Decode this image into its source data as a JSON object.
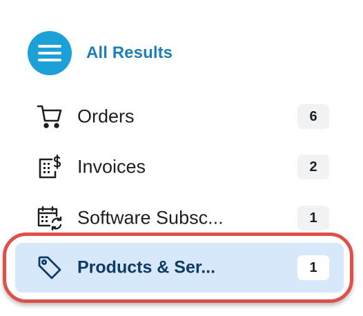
{
  "header": {
    "menu_icon": "hamburger-menu-icon",
    "title": "All Results",
    "accent_color": "#1ba0d8",
    "title_color": "#1d7fb5"
  },
  "nav": {
    "items": [
      {
        "label": "Orders",
        "count": "6",
        "icon": "shopping-cart-icon",
        "selected": false
      },
      {
        "label": "Invoices",
        "count": "2",
        "icon": "invoice-dollar-icon",
        "selected": false
      },
      {
        "label": "Software Subsc...",
        "count": "1",
        "icon": "calendar-refresh-icon",
        "selected": false
      },
      {
        "label": "Products & Ser...",
        "count": "1",
        "icon": "price-tag-icon",
        "selected": true
      }
    ]
  },
  "highlight": {
    "outline_color": "#e0504a",
    "selected_bg": "#d7e8fb"
  }
}
